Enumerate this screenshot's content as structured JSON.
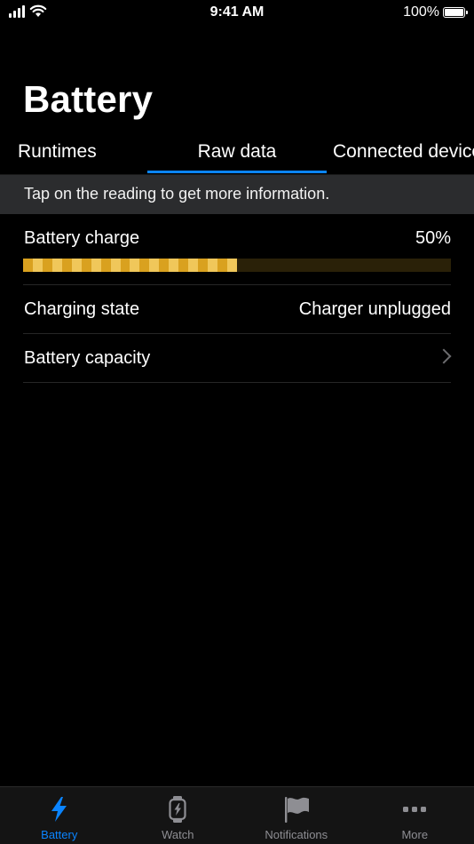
{
  "status_bar": {
    "time": "9:41 AM",
    "battery_percent": "100%"
  },
  "page": {
    "title": "Battery"
  },
  "tabs": [
    {
      "label": "Runtimes",
      "selected": false
    },
    {
      "label": "Raw data",
      "selected": true
    },
    {
      "label": "Connected devices",
      "selected": false
    }
  ],
  "info_banner": {
    "text": "Tap on the reading to get more information."
  },
  "readings": {
    "battery_charge": {
      "label": "Battery charge",
      "value": "50%",
      "fraction": 0.5
    },
    "charging_state": {
      "label": "Charging state",
      "value": "Charger unplugged"
    },
    "battery_capacity": {
      "label": "Battery capacity"
    }
  },
  "tab_bar": {
    "items": [
      {
        "label": "Battery",
        "icon": "bolt-icon",
        "active": true
      },
      {
        "label": "Watch",
        "icon": "watch-icon",
        "active": false
      },
      {
        "label": "Notifications",
        "icon": "flag-icon",
        "active": false
      },
      {
        "label": "More",
        "icon": "more-icon",
        "active": false
      }
    ]
  },
  "colors": {
    "accent": "#0a84ff",
    "charge_fill_a": "#d9a11f",
    "charge_fill_b": "#f0c75a",
    "charge_track": "#2a2108",
    "banner_bg": "#2b2c2e",
    "inactive": "#8e8e93"
  }
}
